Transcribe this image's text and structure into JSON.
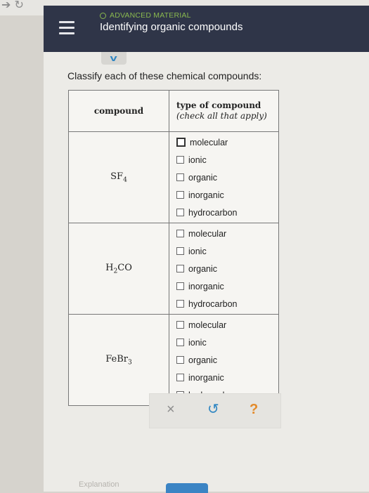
{
  "header": {
    "section": "ADVANCED MATERIAL",
    "title": "Identifying organic compounds"
  },
  "instructions": "Classify each of these chemical compounds:",
  "table": {
    "col1": "compound",
    "col2_line1": "type of compound",
    "col2_line2": "(check all that apply)",
    "rows": [
      {
        "formula": "SF",
        "sub": "4",
        "options": [
          "molecular",
          "ionic",
          "organic",
          "inorganic",
          "hydrocarbon"
        ]
      },
      {
        "formula_a": "H",
        "sub": "2",
        "formula_b": "CO",
        "options": [
          "molecular",
          "ionic",
          "organic",
          "inorganic",
          "hydrocarbon"
        ]
      },
      {
        "formula": "FeBr",
        "sub": "3",
        "options": [
          "molecular",
          "ionic",
          "organic",
          "inorganic",
          "hydrocarbon"
        ]
      }
    ]
  },
  "actions": {
    "clear": "×",
    "undo": "↺",
    "help": "?"
  },
  "footer": {
    "link": "Explanation"
  },
  "colors": {
    "header_bg": "#2f3548",
    "accent_green": "#8ab94f",
    "accent_blue": "#2f86c2",
    "help_orange": "#e38a2a"
  }
}
